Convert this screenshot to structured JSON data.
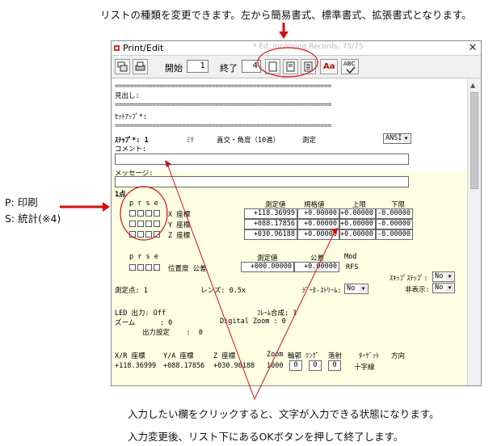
{
  "annotations": {
    "top_caption": "リストの種類を変更できます。左から簡易書式、標準書式、拡張書式となります。",
    "left_caption_p": "P: 印刷",
    "left_caption_s": "S: 統計(※4)",
    "bottom_caption_1": "入力したい欄をクリックすると、文字が入力できる状態になります。",
    "bottom_caption_2": "入力変更後、リスト下にあるOKボタンを押して終了します。",
    "accent_color": "#d01010"
  },
  "window": {
    "title": "Print/Edit",
    "close_icon": "close-x",
    "ghost_title": "* Ed:  Incoming  Records: 75/75"
  },
  "toolbar": {
    "start_label": "開始",
    "start_value": "1",
    "end_label": "終了",
    "end_value": "4",
    "font_button": "Aa",
    "spell_button": "ABC"
  },
  "list": {
    "separator": "==========================================================",
    "midashi": "見出し:",
    "setup": "ｾｯﾄｱｯﾌﾟ*:",
    "step_label": "ｽﾃｯﾌﾟ*: 1",
    "unit": "ﾐﾘ",
    "coord": "直交・角度（10進）",
    "measure": "測定",
    "ansi": "ANSI",
    "comment": "コメント:",
    "message": "メッセージ:",
    "point": "1点",
    "prse": "p r s e",
    "col_measured": "測定値",
    "col_nominal": "規格値",
    "col_upper": "上限",
    "col_lower": "下限",
    "rows": [
      {
        "label": "X 座標",
        "measured": "+118.36999",
        "nominal": "+0.00000",
        "upper": "+0.00000",
        "lower": "-0.00000"
      },
      {
        "label": "Y 座標",
        "measured": "+088.17856",
        "nominal": "+0.00000",
        "upper": "+0.00000",
        "lower": "-0.00000"
      },
      {
        "label": "Z 座標",
        "measured": "+030.96188",
        "nominal": "+0.00000",
        "upper": "+0.00000",
        "lower": "-0.00000"
      }
    ],
    "pos_measured_h": "測定値",
    "pos_tol_h": "公差",
    "pos_mod_h": "Mod",
    "pos_label": "位置度 公差",
    "pos_measured": "+000.00000",
    "pos_tol": "+0.00000",
    "pos_mod": "RFS",
    "skip_step_label": "ｽｷｯﾌﾟｽﾃｯﾌﾟ:",
    "skip_step_value": "No",
    "hidden_label": "非表示:",
    "hidden_value": "No",
    "points_line": "測定点: 1",
    "lens": "レンズ: 0.5x",
    "data_stream_label": "ﾃﾞｰﾀ-ｽﾄﾘｰﾑ:",
    "data_stream_value": "No",
    "led": "LED 出力:  Off",
    "frame": "ﾌﾚｰﾑ合成: 1",
    "zoom": "ズーム      : 0",
    "digital_zoom": "Digital Zoom : 0",
    "output_setting": "出力設定    :  0",
    "bottom_headers": [
      "X/R 座標",
      "Y/A 座標",
      "Z 座標",
      "Zoom",
      "輪郭",
      "ﾘﾝｸﾞ",
      "落射",
      "ﾀｰｹﾞｯﾄ",
      "方向"
    ],
    "bottom_values": {
      "x": "+118.36999",
      "y": "+088.17856",
      "z": "+030.96188",
      "zoom": "1000",
      "rinkaku": "0",
      "ring": "0",
      "rakusha": "0",
      "target": "十字線"
    }
  }
}
